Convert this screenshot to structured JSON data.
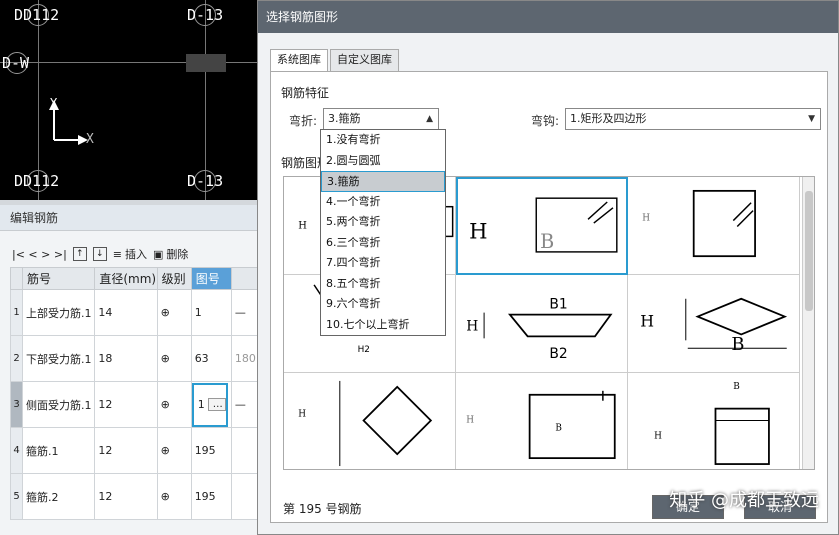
{
  "cad": {
    "labels": [
      "DD112",
      "D-13",
      "D-W",
      "DD112",
      "D-13"
    ],
    "axis_y": "Y",
    "axis_x": "X"
  },
  "edit_panel": {
    "title": "编辑钢筋",
    "toolbar": {
      "nav": "|<  <  >  >|",
      "insert": "插入",
      "delete": "删除"
    },
    "columns": [
      "筋号",
      "直径(mm)",
      "级别",
      "图号"
    ],
    "rows": [
      {
        "idx": "1",
        "name": "上部受力筋.1",
        "diameter": "14",
        "grade": "⊕",
        "fig": "1"
      },
      {
        "idx": "2",
        "name": "下部受力筋.1",
        "diameter": "18",
        "grade": "⊕",
        "fig": "63",
        "extra": "180"
      },
      {
        "idx": "3",
        "name": "侧面受力筋.1",
        "diameter": "12",
        "grade": "⊕",
        "fig": "1",
        "editing": true
      },
      {
        "idx": "4",
        "name": "箍筋.1",
        "diameter": "12",
        "grade": "⊕",
        "fig": "195"
      },
      {
        "idx": "5",
        "name": "箍筋.2",
        "diameter": "12",
        "grade": "⊕",
        "fig": "195"
      }
    ]
  },
  "dialog": {
    "title": "选择钢筋图形",
    "tabs": [
      "系统图库",
      "自定义图库"
    ],
    "feature_label": "钢筋特征",
    "bend_label": "弯折:",
    "bend_value": "3.箍筋",
    "hook_label": "弯钩:",
    "hook_value": "1.矩形及四边形",
    "shape_label": "钢筋图形",
    "bend_options": [
      "1.没有弯折",
      "2.圆与圆弧",
      "3.箍筋",
      "4.一个弯折",
      "5.两个弯折",
      "6.三个弯折",
      "7.四个弯折",
      "8.五个弯折",
      "9.六个弯折",
      "10.七个以上弯折"
    ],
    "selected_option_index": 2,
    "status": "第 195 号钢筋",
    "ok_label": "确定",
    "cancel_label": "取消",
    "shape_labels": {
      "H": "H",
      "B": "B",
      "B1": "B1",
      "B2": "B2",
      "H2": "H2"
    }
  },
  "watermark": "知乎 @成都王致远"
}
